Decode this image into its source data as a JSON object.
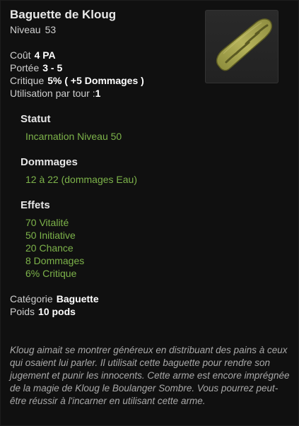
{
  "item": {
    "name": "Baguette de Kloug",
    "level_label": "Niveau",
    "level_value": "53",
    "image_icon": "baguette-bread-icon"
  },
  "stats": {
    "cost_label": "Coût",
    "cost_value": "4 PA",
    "range_label": "Portée",
    "range_value": "3 - 5",
    "critical_label": "Critique",
    "critical_value": "5% ( +5 Dommages )",
    "uses_label": "Utilisation par tour :",
    "uses_value": "1"
  },
  "statut": {
    "heading": "Statut",
    "text": "Incarnation Niveau 50"
  },
  "dommages": {
    "heading": "Dommages",
    "text": "12 à 22 (dommages Eau)"
  },
  "effets": {
    "heading": "Effets",
    "items": [
      "70 Vitalité",
      "50 Initiative",
      "20 Chance",
      "8 Dommages",
      "6% Critique"
    ]
  },
  "category": {
    "category_label": "Catégorie",
    "category_value": "Baguette",
    "weight_label": "Poids",
    "weight_value": "10 pods"
  },
  "description": "Kloug aimait se montrer généreux en distribuant des pains à ceux qui osaient lui parler. Il utilisait cette baguette pour rendre son jugement et punir les innocents. Cette arme est encore imprégnée de la magie de Kloug le Boulanger Sombre. Vous pourrez peut-être réussir à l'incarner en utilisant cette arme.",
  "colors": {
    "effect_green": "#7db34a",
    "background": "#101010"
  }
}
